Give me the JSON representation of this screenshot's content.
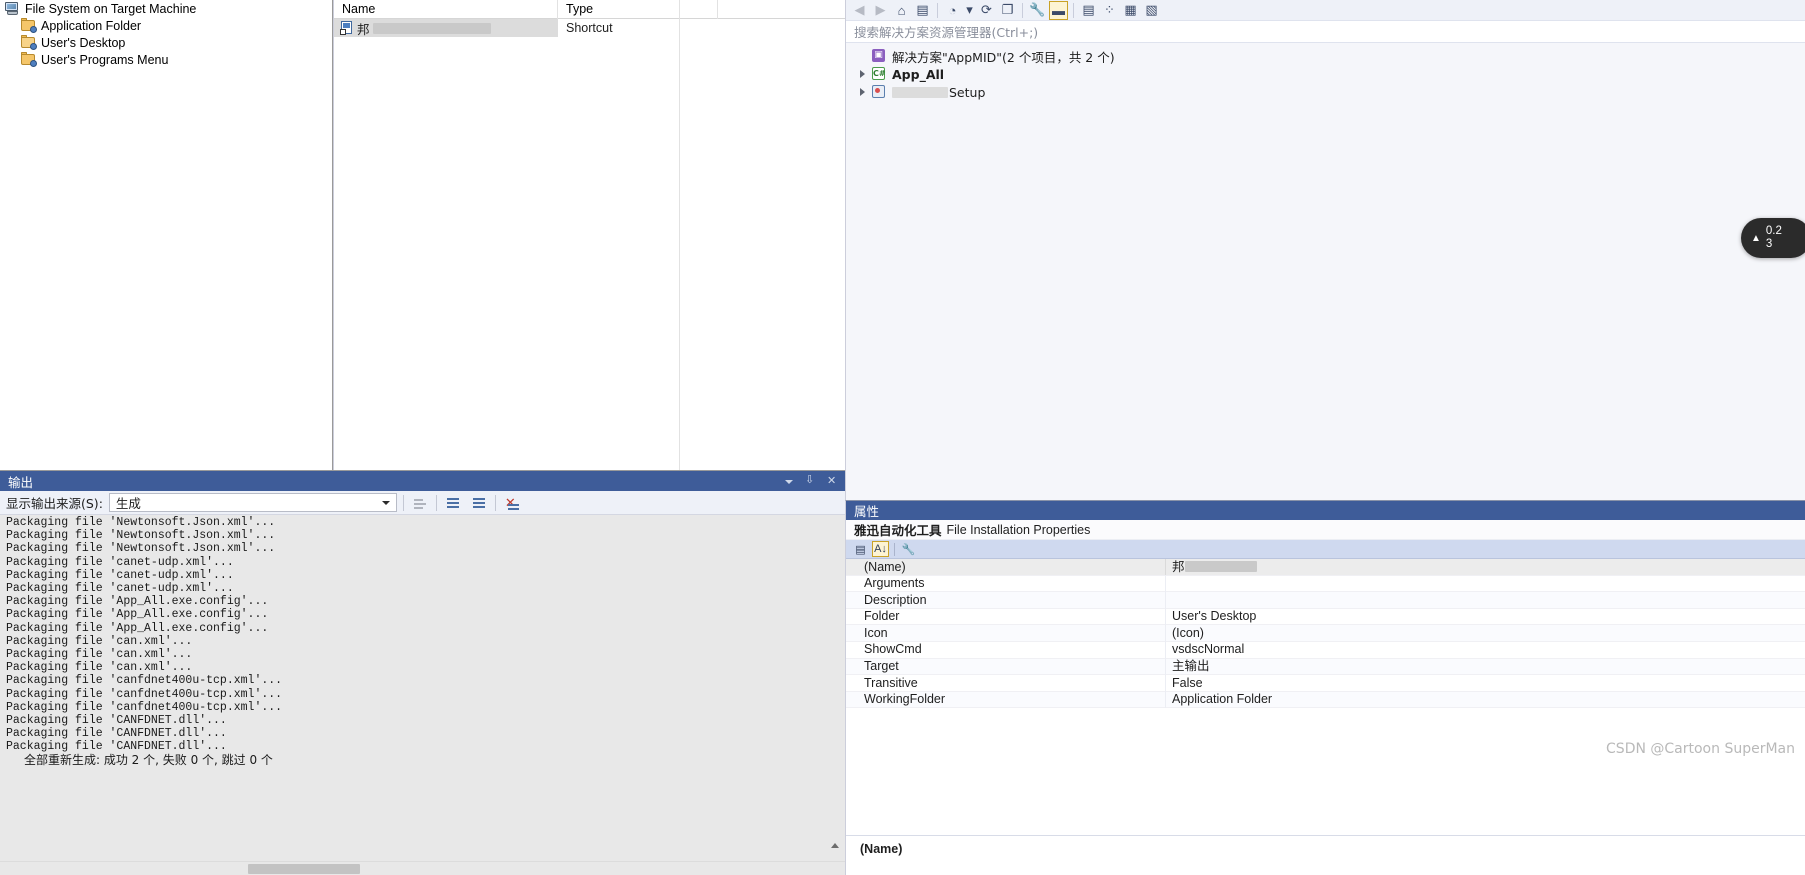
{
  "file_system_editor": {
    "tree": [
      {
        "label": "File System on Target Machine",
        "icon": "computer-icon",
        "level": 0
      },
      {
        "label": "Application Folder",
        "icon": "folder-icon",
        "level": 1
      },
      {
        "label": "User's Desktop",
        "icon": "folder-open-icon",
        "level": 1
      },
      {
        "label": "User's Programs Menu",
        "icon": "folder-icon",
        "level": 1
      }
    ],
    "list": {
      "columns": [
        "Name",
        "Type"
      ],
      "rows": [
        {
          "name": "邦",
          "name_redacted": true,
          "type": "Shortcut",
          "icon": "shortcut-icon",
          "selected": true
        }
      ]
    }
  },
  "output_panel": {
    "title": "输出",
    "source_label": "显示输出来源(S):",
    "source_value": "生成",
    "toolbar_icons": [
      "jump-to-source-icon",
      "go-to-previous-message-icon",
      "go-to-next-message-icon",
      "clear-all-icon"
    ],
    "title_buttons": [
      "window-menu-icon",
      "pin-icon",
      "close-icon"
    ],
    "log_lines": [
      "Packaging file 'Newtonsoft.Json.xml'...",
      "Packaging file 'Newtonsoft.Json.xml'...",
      "Packaging file 'Newtonsoft.Json.xml'...",
      "Packaging file 'canet-udp.xml'...",
      "Packaging file 'canet-udp.xml'...",
      "Packaging file 'canet-udp.xml'...",
      "Packaging file 'App_All.exe.config'...",
      "Packaging file 'App_All.exe.config'...",
      "Packaging file 'App_All.exe.config'...",
      "Packaging file 'can.xml'...",
      "Packaging file 'can.xml'...",
      "Packaging file 'can.xml'...",
      "Packaging file 'canfdnet400u-tcp.xml'...",
      "Packaging file 'canfdnet400u-tcp.xml'...",
      "Packaging file 'canfdnet400u-tcp.xml'...",
      "Packaging file 'CANFDNET.dll'...",
      "Packaging file 'CANFDNET.dll'...",
      "Packaging file 'CANFDNET.dll'..."
    ],
    "summary_line": "全部重新生成: 成功 2 个, 失败 0 个, 跳过 0 个"
  },
  "solution_explorer": {
    "toolbar_icons": [
      "back-icon",
      "forward-icon",
      "home-icon",
      "sync-with-active-document-icon",
      "pending-changes-filter-icon",
      "filter-dropdown-icon",
      "refresh-icon",
      "collapse-all-icon",
      "properties-wrench-icon",
      "show-all-files-icon",
      "preview-selected-items-icon",
      "add-new-item-icon",
      "view-code-icon",
      "view-designer-icon"
    ],
    "search_placeholder": "搜索解决方案资源管理器(Ctrl+;)",
    "tree": [
      {
        "label": "解决方案\"AppMID\"(2 个项目，共 2 个)",
        "icon": "solution-icon",
        "expandable": false,
        "bold": false
      },
      {
        "label": "App_All",
        "icon": "csharp-project-icon",
        "expandable": true,
        "bold": true
      },
      {
        "label": "Setup",
        "label_prefix_redacted": true,
        "icon": "setup-project-icon",
        "expandable": true,
        "bold": false
      }
    ]
  },
  "toast": {
    "line1": "0.2",
    "line2": "3",
    "arrow": "▲"
  },
  "properties_panel": {
    "title": "属性",
    "object_name": "雅迅自动化工具",
    "object_type": "File Installation Properties",
    "toolbar_icons": [
      "categorized-icon",
      "alphabetical-sort-icon",
      "property-pages-wrench-icon"
    ],
    "rows": [
      {
        "name": "(Name)",
        "value": "邦",
        "value_redacted": true,
        "selected": true
      },
      {
        "name": "Arguments",
        "value": ""
      },
      {
        "name": "Description",
        "value": ""
      },
      {
        "name": "Folder",
        "value": "User's Desktop"
      },
      {
        "name": "Icon",
        "value": "(Icon)"
      },
      {
        "name": "ShowCmd",
        "value": "vsdscNormal"
      },
      {
        "name": "Target",
        "value": "主输出"
      },
      {
        "name": "Transitive",
        "value": "False"
      },
      {
        "name": "WorkingFolder",
        "value": "Application Folder"
      }
    ],
    "description_name": "(Name)"
  },
  "watermark": "CSDN @Cartoon SuperMan",
  "colors": {
    "title_bar": "#3e5c99",
    "toolbar_bg": "#eef1f8",
    "selection": "#dcdcdc",
    "accent_gold": "#c9a227",
    "output_bg": "#e8e8e8"
  }
}
